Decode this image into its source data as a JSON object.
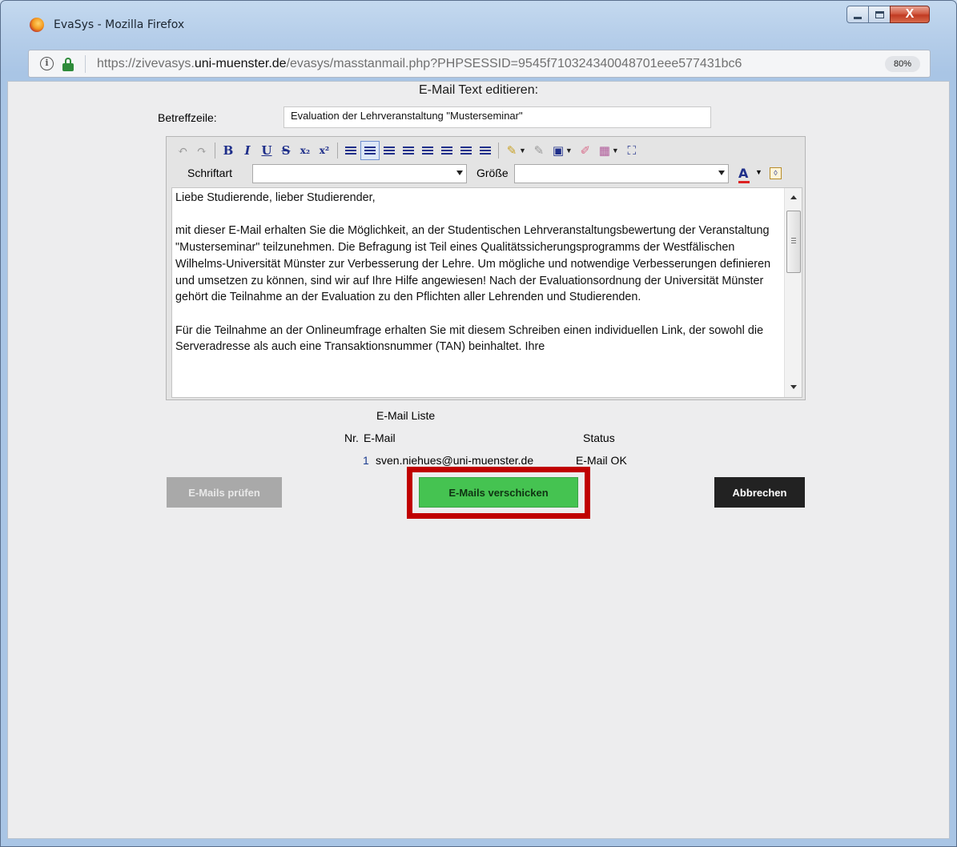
{
  "window": {
    "title": "EvaSys - Mozilla Firefox",
    "close_glyph": "X"
  },
  "urlbar": {
    "info_glyph": "i",
    "url_prefix": "https://zivevasys.",
    "url_domain": "uni-muenster.de",
    "url_path": "/evasys/masstanmail.php?PHPSESSID=9545f710324340048701eee577431bc6",
    "zoom": "80%"
  },
  "page": {
    "heading": "E-Mail Text editieren:",
    "subject_label": "Betreffzeile:",
    "subject_value": "Evaluation der Lehrveranstaltung \"Musterseminar\""
  },
  "editor": {
    "toolbar": {
      "bold": "B",
      "italic": "I",
      "underline": "U",
      "strike": "S",
      "subscript": "x₂",
      "superscript": "x²"
    },
    "font_label": "Schriftart",
    "size_label": "Größe",
    "text_color_glyph": "A",
    "paragraphs": [
      "Liebe Studierende, lieber Studierender,",
      "mit dieser E-Mail erhalten Sie die Möglichkeit, an der Studentischen Lehrveranstaltungsbewertung der Veranstaltung \"Musterseminar\" teilzunehmen. Die Befragung ist Teil eines Qualitätssicherungsprogramms der Westfälischen Wilhelms-Universität Münster zur Verbesserung der Lehre. Um mögliche und notwendige Verbesserungen definieren und umsetzen zu können, sind wir auf Ihre Hilfe angewiesen! Nach der Evaluationsordnung der Universität Münster gehört die Teilnahme an der Evaluation zu den Pflichten aller Lehrenden und Studierenden.",
      "Für die Teilnahme an der Onlineumfrage erhalten Sie mit diesem Schreiben einen individuellen Link, der sowohl die Serveradresse als auch eine Transaktionsnummer (TAN) beinhaltet. Ihre"
    ]
  },
  "email_list": {
    "title": "E-Mail Liste",
    "col_nr": "Nr.",
    "col_email": "E-Mail",
    "col_status": "Status",
    "rows": [
      {
        "nr": "1",
        "email": "sven.niehues@uni-muenster.de",
        "status": "E-Mail OK"
      }
    ]
  },
  "buttons": {
    "check": "E-Mails prüfen",
    "send": "E-Mails verschicken",
    "cancel": "Abbrechen"
  },
  "colors": {
    "send_button": "#45c351",
    "highlight": "#c00000",
    "cancel_button": "#222222"
  }
}
